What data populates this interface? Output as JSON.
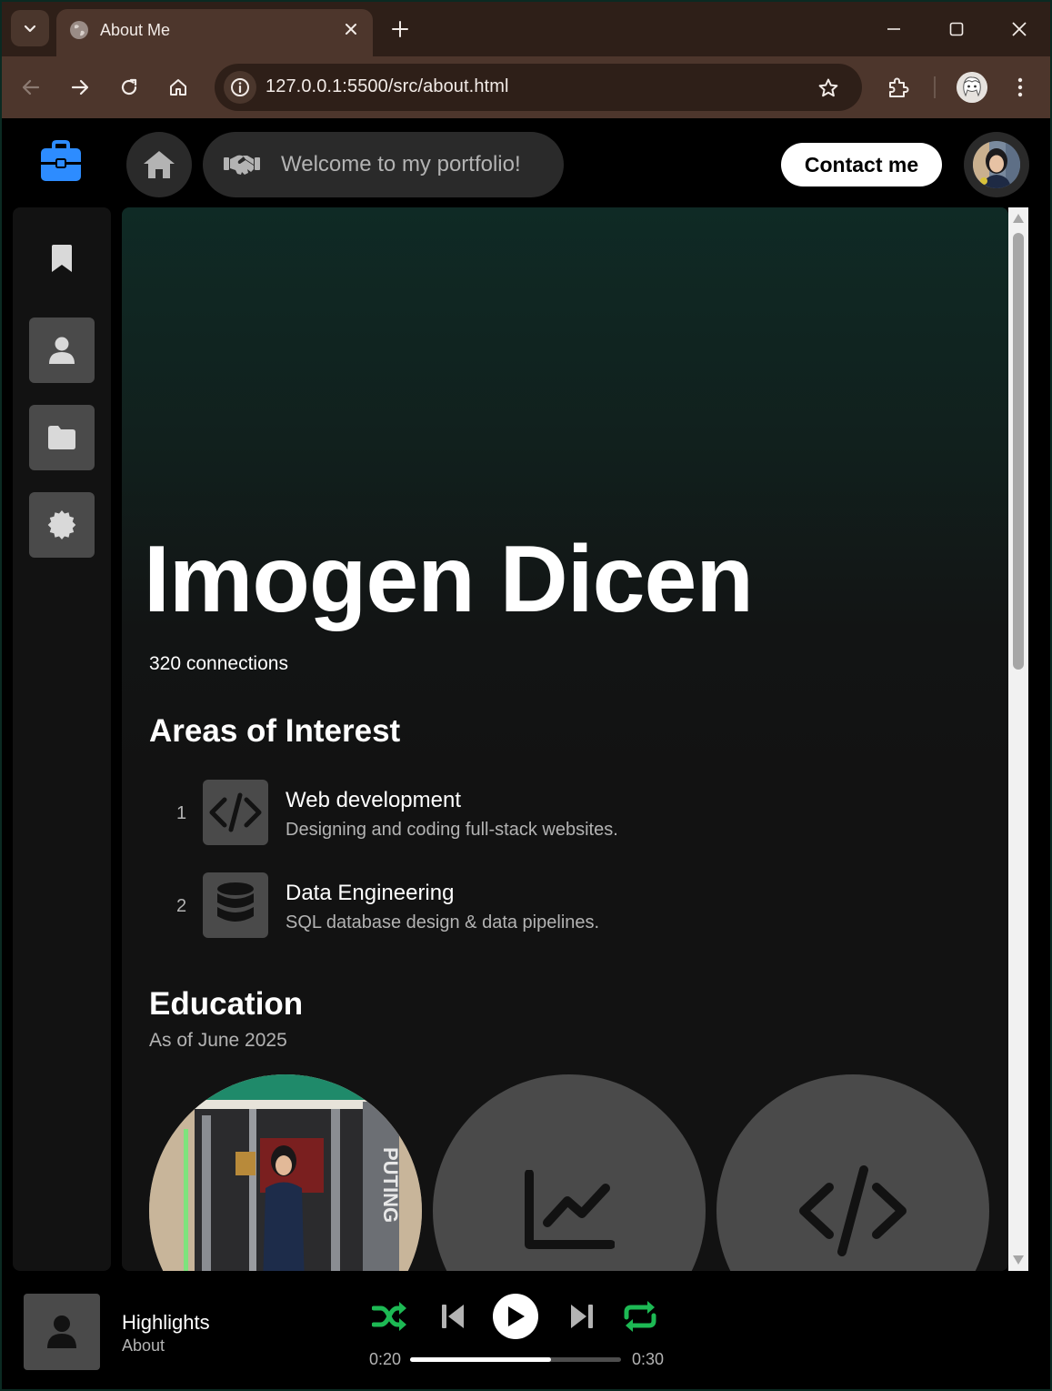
{
  "browser": {
    "tab_title": "About Me",
    "url": "127.0.0.1:5500/src/about.html"
  },
  "header": {
    "welcome_text": "Welcome to my portfolio!",
    "contact_label": "Contact me"
  },
  "sidebar": {
    "items": [
      {
        "icon": "bookmark-icon"
      },
      {
        "icon": "user-icon"
      },
      {
        "icon": "folder-icon"
      },
      {
        "icon": "certificate-icon"
      }
    ]
  },
  "profile": {
    "name": "Imogen Dicen",
    "connections": "320 connections"
  },
  "interests": {
    "title": "Areas of Interest",
    "items": [
      {
        "num": "1",
        "icon": "code-icon",
        "title": "Web development",
        "desc": "Designing and coding full-stack websites."
      },
      {
        "num": "2",
        "icon": "database-icon",
        "title": "Data Engineering",
        "desc": "SQL database design & data pipelines."
      }
    ]
  },
  "education": {
    "title": "Education",
    "subtitle": "As of June 2025",
    "cards": [
      {
        "icon": "photo"
      },
      {
        "icon": "chart-line-icon"
      },
      {
        "icon": "code-icon"
      }
    ]
  },
  "player": {
    "title": "Highlights",
    "subtitle": "About",
    "elapsed": "0:20",
    "duration": "0:30",
    "progress": 0.67,
    "accent": "#1db954"
  },
  "colors": {
    "brand": "#2d8cff",
    "chrome": "#4d362c",
    "surface": "#121212"
  }
}
